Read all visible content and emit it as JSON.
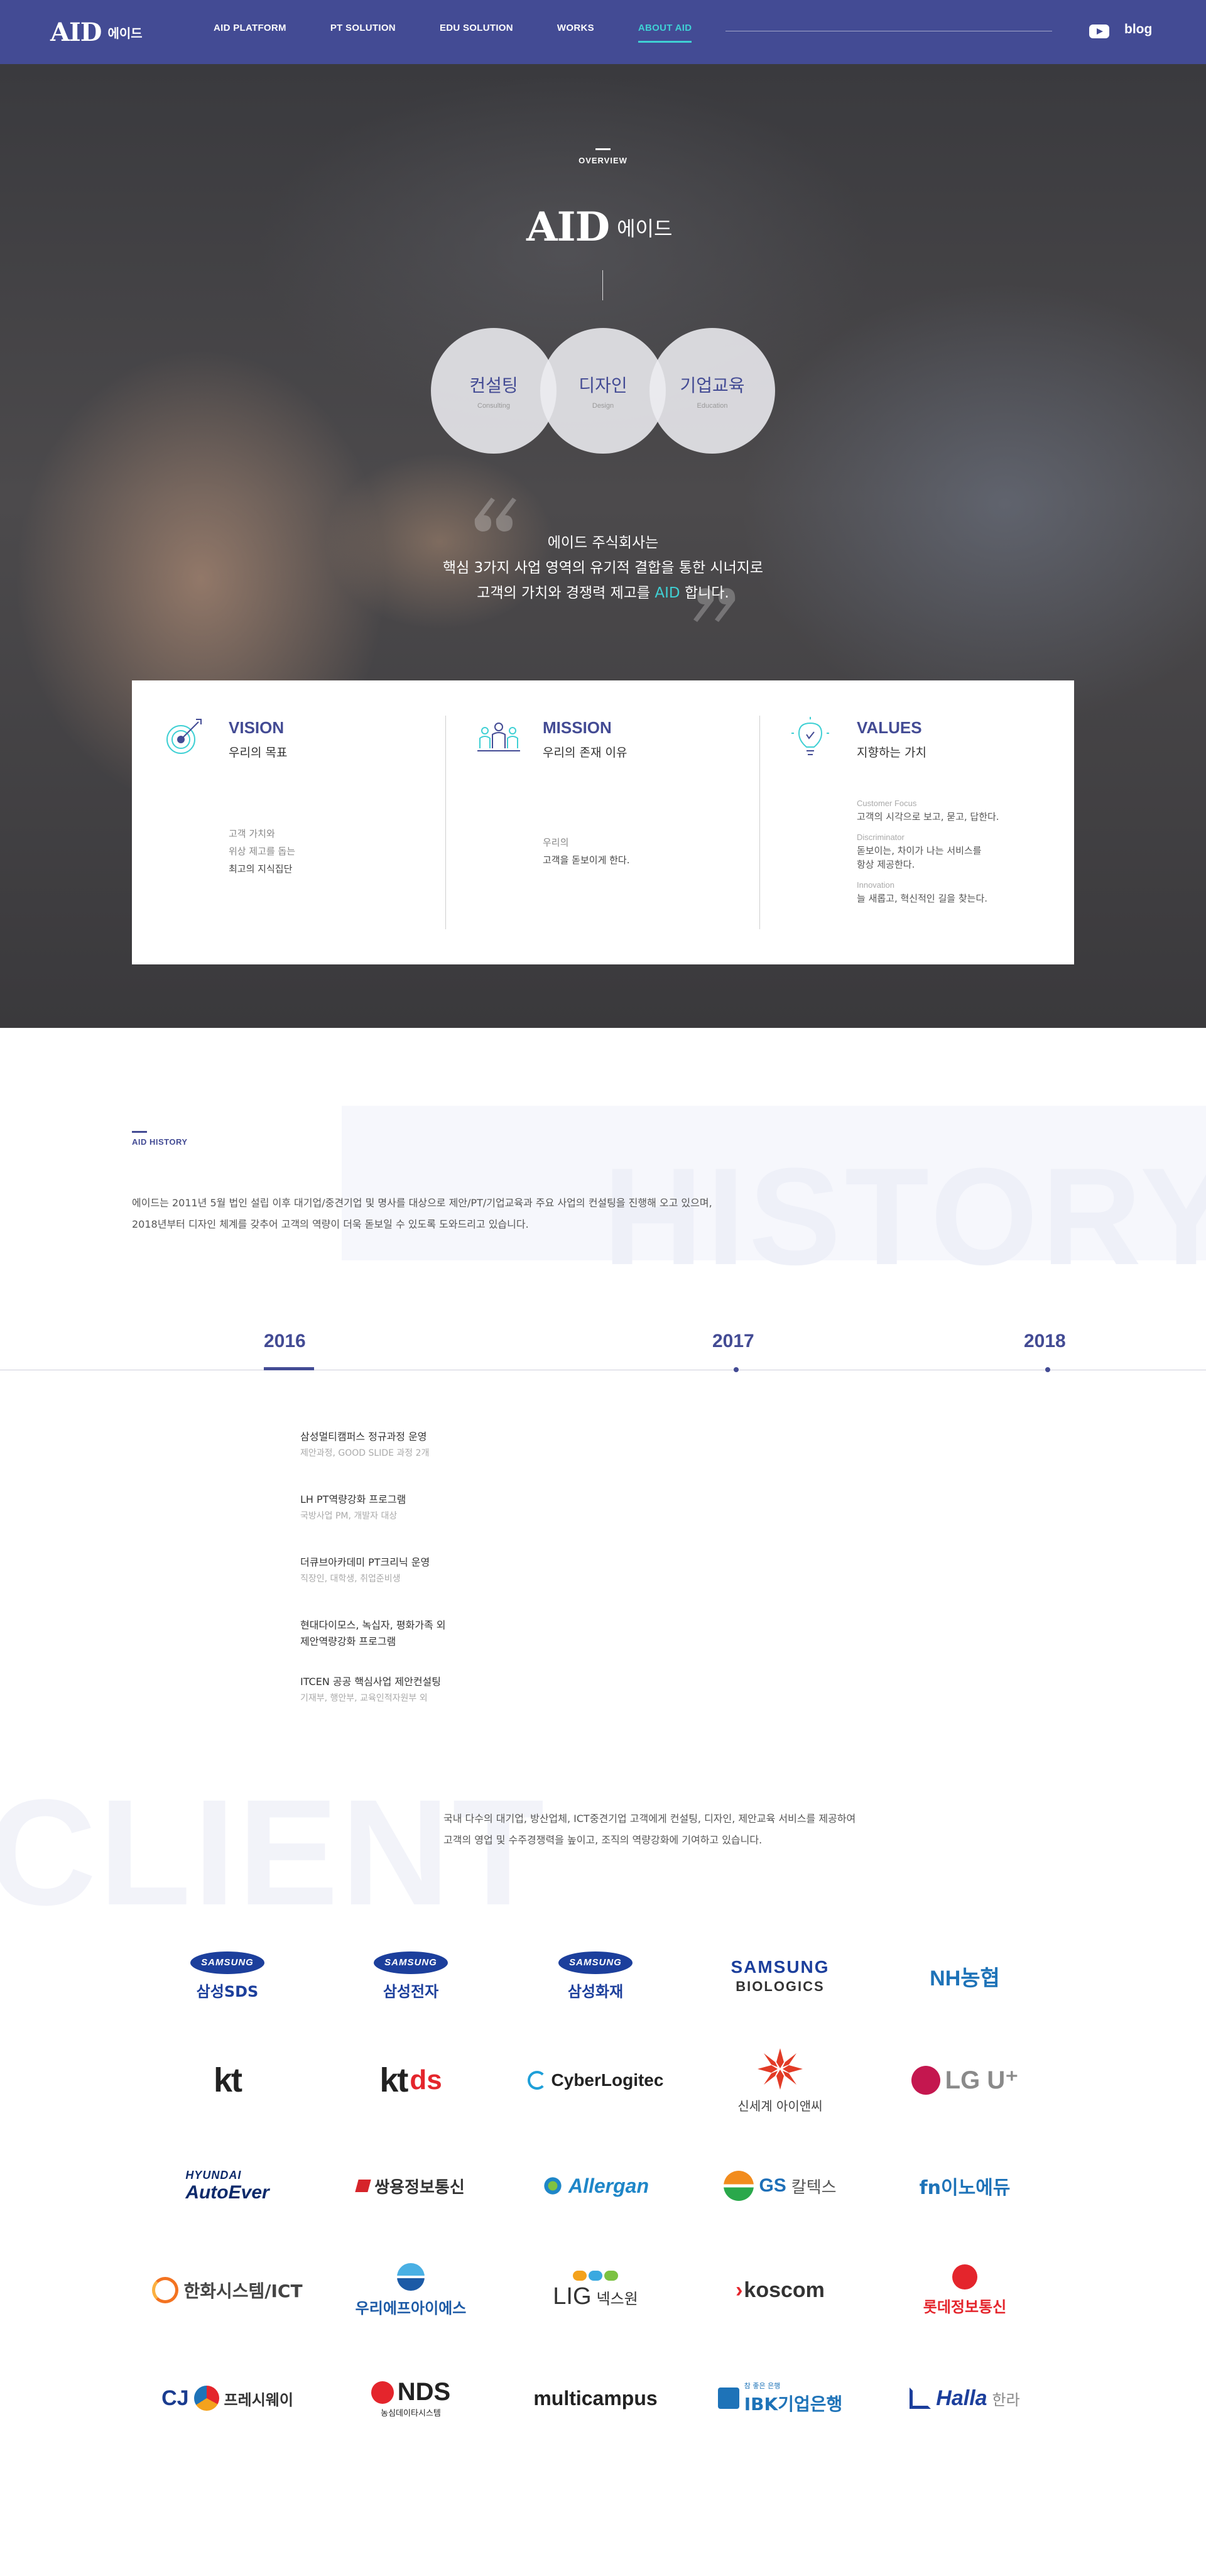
{
  "header": {
    "logo_mark": "AID",
    "logo_text": "에이드",
    "nav": [
      "AID PLATFORM",
      "PT SOLUTION",
      "EDU SOLUTION",
      "WORKS",
      "ABOUT AID"
    ],
    "active_nav": "ABOUT AID",
    "blog_label": "blog"
  },
  "overview": {
    "label": "OVERVIEW",
    "logo_mark": "AID",
    "logo_text": "에이드",
    "circles": [
      {
        "title": "컨설팅",
        "sub": "Consulting"
      },
      {
        "title": "디자인",
        "sub": "Design"
      },
      {
        "title": "기업교육",
        "sub": "Education"
      }
    ],
    "statement": {
      "line1": "에이드 주식회사는",
      "line2": "핵심 3가지 사업 영역의 유기적 결합을 통한 시너지로",
      "line3_pre": "고객의 가치와 경쟁력 제고를 ",
      "line3_accent": "AID",
      "line3_post": " 합니다."
    }
  },
  "cards": {
    "vision": {
      "title": "VISION",
      "subtitle": "우리의 목표",
      "body": [
        "고객 가치와",
        "위상 제고를 돕는"
      ],
      "body_strong": "최고의 지식집단"
    },
    "mission": {
      "title": "MISSION",
      "subtitle": "우리의 존재 이유",
      "body": [
        "우리의",
        "고객을 돋보이게 한다."
      ]
    },
    "values": {
      "title": "VALUES",
      "subtitle": "지향하는 가치",
      "items": [
        {
          "tag": "Customer Focus",
          "desc": [
            "고객의 시각으로 보고, 묻고, 답한다."
          ]
        },
        {
          "tag": "Discriminator",
          "desc": [
            "돋보이는, 차이가 나는 서비스를",
            "항상 제공한다."
          ]
        },
        {
          "tag": "Innovation",
          "desc": [
            "늘 새롭고, 혁신적인 길을 찾는다."
          ]
        }
      ]
    }
  },
  "history": {
    "label": "AID HISTORY",
    "bg_word": "HISTORY",
    "desc": [
      "에이드는 2011년 5월 법인 설립 이후 대기업/중견기업 및 명사를 대상으로 제안/PT/기업교육과 주요 사업의 컨설팅을 진행해 오고 있으며,",
      "2018년부터 디자인 체계를 갖추어 고객의 역량이 더욱 돋보일 수 있도록 도와드리고 있습니다."
    ],
    "years": [
      "2016",
      "2017",
      "2018"
    ],
    "active_year": "2016",
    "items": [
      {
        "title": "삼성멀티캠퍼스 정규과정 운영",
        "note": "제안과정, GOOD SLIDE 과정 2개"
      },
      {
        "title": "LH PT역량강화 프로그램",
        "note": "국방사업 PM, 개발자 대상"
      },
      {
        "title": "더큐브아카데미 PT크리닉 운영",
        "note": "직장인, 대학생, 취업준비생"
      },
      {
        "title": [
          "현대다이모스, 녹십자, 평화가족 외",
          "제안역량강화 프로그램"
        ],
        "note": ""
      },
      {
        "title": "ITCEN 공공 핵심사업 제안컨설팅",
        "note": "기재부, 행안부, 교육인적자원부 외"
      }
    ]
  },
  "client": {
    "bg_word": "CLIENT",
    "desc": [
      "국내 다수의 대기업, 방산업체, ICT중견기업 고객에게 컨설팅, 디자인, 제안교육 서비스를 제공하여",
      "고객의 영업 및 수주경쟁력을 높이고, 조직의 역량강화에 기여하고 있습니다."
    ],
    "logos": [
      {
        "id": "samsung-sds",
        "oval": "SAMSUNG",
        "text": "삼성SDS"
      },
      {
        "id": "samsung-electronics",
        "oval": "SAMSUNG",
        "text": "삼성전자"
      },
      {
        "id": "samsung-fire",
        "oval": "SAMSUNG",
        "text": "삼성화재"
      },
      {
        "id": "samsung-biologics",
        "line1": "SAMSUNG",
        "line2": "BIOLOGICS"
      },
      {
        "id": "nh",
        "text": "NH농협"
      },
      {
        "id": "kt",
        "text": "kt"
      },
      {
        "id": "kt-ds",
        "text1": "kt",
        "text2": "ds"
      },
      {
        "id": "cyberlogitec",
        "text": "CyberLogitec"
      },
      {
        "id": "shinsegae-inc",
        "text": "신세계 아이앤씨"
      },
      {
        "id": "lg-uplus",
        "text": "LG U⁺"
      },
      {
        "id": "hyundai-autoever",
        "line1": "HYUNDAI",
        "line2": "AutoEver"
      },
      {
        "id": "ssangyong",
        "text": "쌍용정보통신"
      },
      {
        "id": "allergan",
        "text": "Allergan"
      },
      {
        "id": "gs-caltex",
        "text1": "GS",
        "text2": "칼텍스"
      },
      {
        "id": "fnedu",
        "text": "fn이노에듀"
      },
      {
        "id": "hanwha",
        "text": "한화시스템/ICT"
      },
      {
        "id": "woori-fis",
        "text": "우리에프아이에스"
      },
      {
        "id": "lig",
        "text1": "LIG",
        "text2": "넥스원"
      },
      {
        "id": "koscom",
        "text": "koscom"
      },
      {
        "id": "lotte",
        "text": "롯데정보통신"
      },
      {
        "id": "cj",
        "text1": "CJ",
        "text2": "프레시웨이"
      },
      {
        "id": "nds",
        "line1": "NDS",
        "line2": "농심데이타시스템"
      },
      {
        "id": "multicampus",
        "text": "multicampus"
      },
      {
        "id": "ibk",
        "small": "참 좋은 은행",
        "text": "IBK기업은행"
      },
      {
        "id": "halla",
        "text1": "Halla",
        "text2": "한라"
      }
    ]
  },
  "colors": {
    "brand": "#434b94",
    "accent": "#3fd0d4"
  }
}
